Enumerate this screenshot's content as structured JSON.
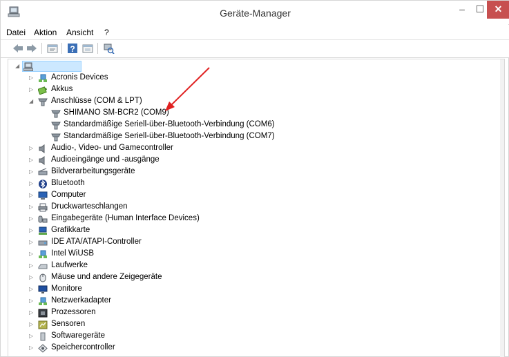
{
  "window": {
    "title": "Geräte-Manager"
  },
  "title_buttons": {
    "minimize": "–",
    "maximize": "☐",
    "close": "✕"
  },
  "menu": [
    "Datei",
    "Aktion",
    "Ansicht",
    "?"
  ],
  "toolbar": {
    "buttons": [
      "back-icon",
      "forward-icon",
      "properties-icon",
      "help-icon",
      "show-hidden-icon",
      "scan-hardware-icon"
    ]
  },
  "tree": {
    "root": {
      "label": "",
      "icon": "computer-icon",
      "expanded": true
    },
    "items": [
      {
        "label": "Acronis Devices",
        "icon": "network-device-icon",
        "expanded": false,
        "level": 1
      },
      {
        "label": "Akkus",
        "icon": "battery-icon",
        "expanded": false,
        "level": 1
      },
      {
        "label": "Anschlüsse (COM & LPT)",
        "icon": "port-icon",
        "expanded": true,
        "level": 1
      },
      {
        "label": "SHIMANO SM-BCR2 (COM9)",
        "icon": "port-icon",
        "level": 2
      },
      {
        "label": "Standardmäßige Seriell-über-Bluetooth-Verbindung (COM6)",
        "icon": "port-icon",
        "level": 2
      },
      {
        "label": "Standardmäßige Seriell-über-Bluetooth-Verbindung (COM7)",
        "icon": "port-icon",
        "level": 2
      },
      {
        "label": "Audio-, Video- und Gamecontroller",
        "icon": "speaker-icon",
        "expanded": false,
        "level": 1
      },
      {
        "label": "Audioeingänge und -ausgänge",
        "icon": "speaker-icon",
        "expanded": false,
        "level": 1
      },
      {
        "label": "Bildverarbeitungsgeräte",
        "icon": "scanner-icon",
        "expanded": false,
        "level": 1
      },
      {
        "label": "Bluetooth",
        "icon": "bluetooth-icon",
        "expanded": false,
        "level": 1
      },
      {
        "label": "Computer",
        "icon": "computer-icon",
        "expanded": false,
        "level": 1
      },
      {
        "label": "Druckwarteschlangen",
        "icon": "printer-icon",
        "expanded": false,
        "level": 1
      },
      {
        "label": "Eingabegeräte (Human Interface Devices)",
        "icon": "hid-icon",
        "expanded": false,
        "level": 1
      },
      {
        "label": "Grafikkarte",
        "icon": "display-adapter-icon",
        "expanded": false,
        "level": 1
      },
      {
        "label": "IDE ATA/ATAPI-Controller",
        "icon": "ide-controller-icon",
        "expanded": false,
        "level": 1
      },
      {
        "label": "Intel WiUSB",
        "icon": "network-device-icon",
        "expanded": false,
        "level": 1
      },
      {
        "label": "Laufwerke",
        "icon": "disk-drive-icon",
        "expanded": false,
        "level": 1
      },
      {
        "label": "Mäuse und andere Zeigegeräte",
        "icon": "mouse-icon",
        "expanded": false,
        "level": 1
      },
      {
        "label": "Monitore",
        "icon": "monitor-icon",
        "expanded": false,
        "level": 1
      },
      {
        "label": "Netzwerkadapter",
        "icon": "network-adapter-icon",
        "expanded": false,
        "level": 1
      },
      {
        "label": "Prozessoren",
        "icon": "processor-icon",
        "expanded": false,
        "level": 1
      },
      {
        "label": "Sensoren",
        "icon": "sensor-icon",
        "expanded": false,
        "level": 1
      },
      {
        "label": "Softwaregeräte",
        "icon": "software-device-icon",
        "expanded": false,
        "level": 1
      },
      {
        "label": "Speichercontroller",
        "icon": "storage-controller-icon",
        "expanded": false,
        "level": 1
      }
    ]
  },
  "colors": {
    "close_button": "#c74f4f",
    "selection": "#cce8ff",
    "annotation_arrow": "#e02020"
  }
}
